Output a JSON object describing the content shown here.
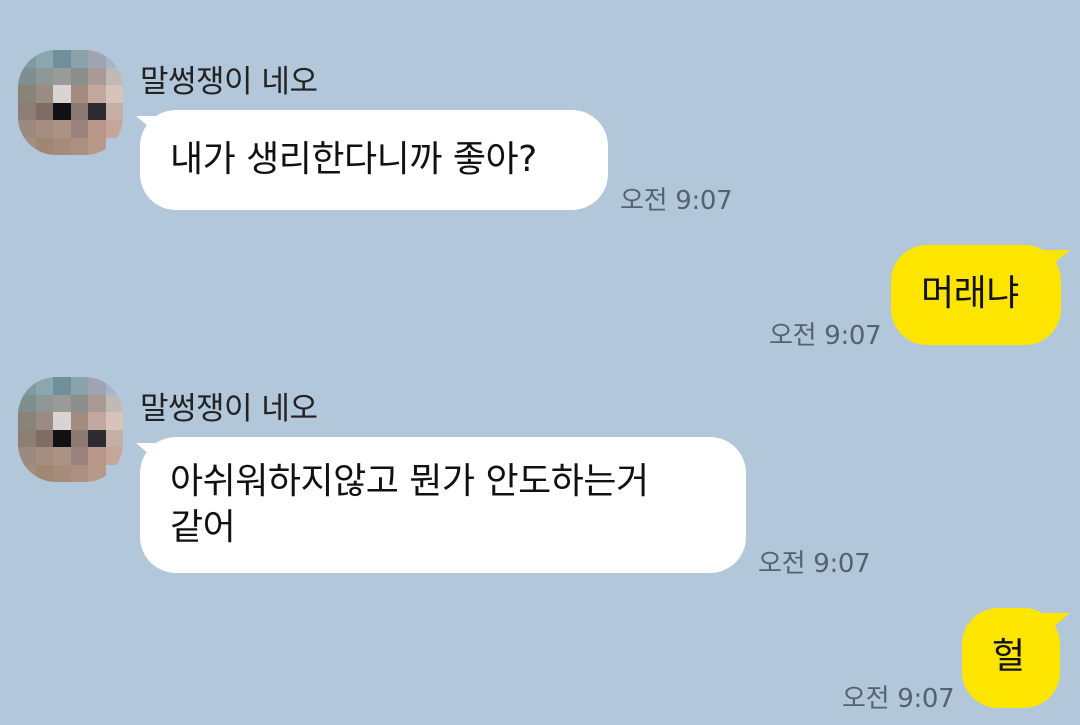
{
  "messages": [
    {
      "sender": "말썽쟁이 네오",
      "text": "내가 생리한다니까 좋아?",
      "time": "오전 9:07"
    },
    {
      "text": "머래냐",
      "time": "오전 9:07"
    },
    {
      "sender": "말썽쟁이 네오",
      "text_line1": "아쉬워하지않고 뭔가 안도하는거",
      "text_line2": "같어",
      "time": "오전 9:07"
    },
    {
      "text": "헐",
      "time": "오전 9:07"
    }
  ],
  "colors": {
    "background": "#b2c7da",
    "incoming_bubble": "#ffffff",
    "outgoing_bubble": "#fee500"
  }
}
